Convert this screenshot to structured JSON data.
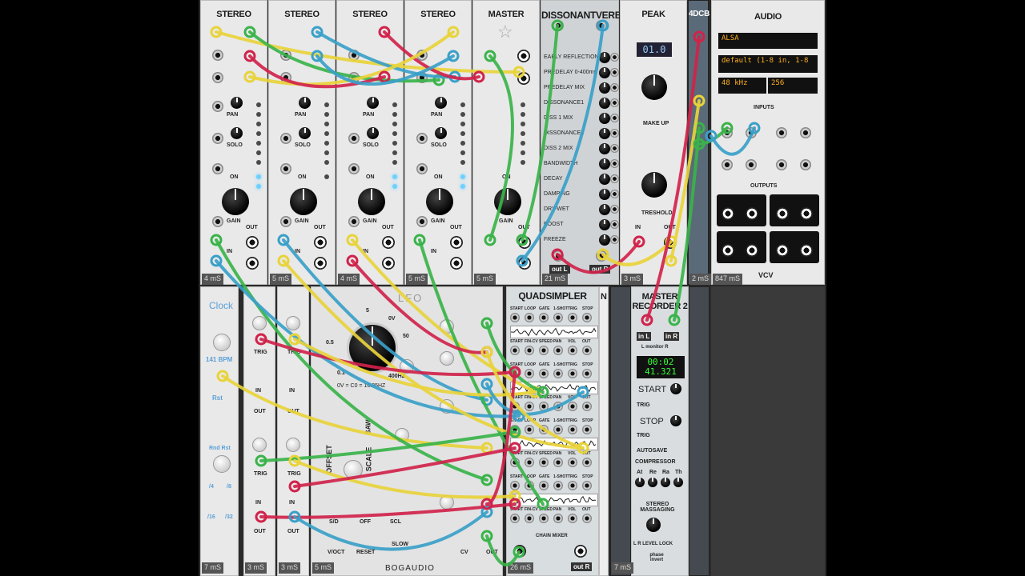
{
  "modules": {
    "stereo_titles": [
      "STEREO",
      "STEREO",
      "STEREO",
      "STEREO"
    ],
    "master_title": "MASTER",
    "reverb_title": "DISSONANTVERB",
    "reverb_params": [
      "EARLY REFLECTIONS",
      "PREDELAY 0-400ms",
      "PREDELAY MIX",
      "DISSONANCE1",
      "DISS 1 MIX",
      "DISSONANCE2",
      "DISS 2 MIX",
      "BANDWIDTH",
      "DECAY",
      "DAMPING",
      "DRY-WET",
      "BOOST",
      "FREEZE"
    ],
    "reverb_out_l": "out L",
    "reverb_out_r": "out R",
    "peak_title": "PEAK",
    "peak_display": "01.0",
    "peak_makeup": "MAKE UP",
    "peak_threshold": "TRESHOLD",
    "fourdcb_title": "4DCB",
    "audio_title": "AUDIO",
    "audio_driver": "ALSA",
    "audio_device": "default (1-8 in, 1-8",
    "audio_rate": "48 kHz",
    "audio_block": "256",
    "audio_inputs": "INPUTS",
    "audio_outputs": "OUTPUTS",
    "audio_brand": "VCV",
    "clock_title": "Clock",
    "clock_bpm": "141 BPM",
    "clock_reset": "Rst",
    "clock_rnd_rst": "Rnd Rst",
    "clock_divs": [
      "/4",
      "/8",
      "/16",
      "/32"
    ],
    "lfo_title": "LFO",
    "lfo_brand": "BOGAUDIO",
    "lfo_freq_labels": [
      "5",
      "0V",
      "50",
      "0.5",
      "200",
      "0.1",
      "400HZ"
    ],
    "lfo_formula": "0V = C0 = 16.35HZ",
    "lfo_offset": "OFFSET",
    "lfo_scale": "SCALE",
    "lfo_wave": "SAW",
    "lfo_bottom": [
      "S/D",
      "OFF",
      "SCL",
      "V/OCT",
      "RESET",
      "SLOW",
      "CV",
      "OUT"
    ],
    "quad_title": "QUADSIMPLER",
    "quad_row_labels": [
      "START",
      "LOOP",
      "GATE",
      "1-SHOT",
      "TRIG",
      "STOP"
    ],
    "quad_speed_labels": [
      "START",
      "FIN-CV",
      "SPEED",
      "PAN",
      "VOL",
      "OUT"
    ],
    "quad_chain": "CHAIN MIXER",
    "recorder_title": "MASTER RECORDER 2",
    "recorder_in_l": "in L",
    "recorder_in_r": "in R",
    "recorder_monitor": "L monitor R",
    "recorder_time1": "00:02",
    "recorder_time2": "41.321",
    "recorder_start": "START",
    "recorder_stop": "STOP",
    "recorder_trig": "TRIG",
    "recorder_autosave": "AUTOSAVE",
    "recorder_compressor": "COMPRESSOR",
    "recorder_comp_knobs": [
      "At",
      "Re",
      "Ra",
      "Th"
    ],
    "recorder_stereo": "STEREO MASSAGING",
    "recorder_lr": "L R LEVEL LOCK",
    "recorder_phase": "phase invert",
    "stereo_labels": [
      "PAN",
      "SOLO",
      "ON",
      "GAIN",
      "IN",
      "OUT"
    ],
    "trig_labels": [
      "TRIG",
      "IN",
      "OUT"
    ]
  },
  "cpu": {
    "top": [
      "4 mS",
      "5 mS",
      "4 mS",
      "5 mS",
      "5 mS",
      "21 mS",
      "3 mS",
      "2 mS",
      "847 mS"
    ],
    "bottom": [
      "7 mS",
      "3 mS",
      "3 mS",
      "5 mS",
      "26 mS",
      "7 mS"
    ]
  },
  "cable_colors": {
    "yellow": "#e8d33a",
    "green": "#3ab34a",
    "blue": "#3aa0c8",
    "red": "#d0234b"
  }
}
